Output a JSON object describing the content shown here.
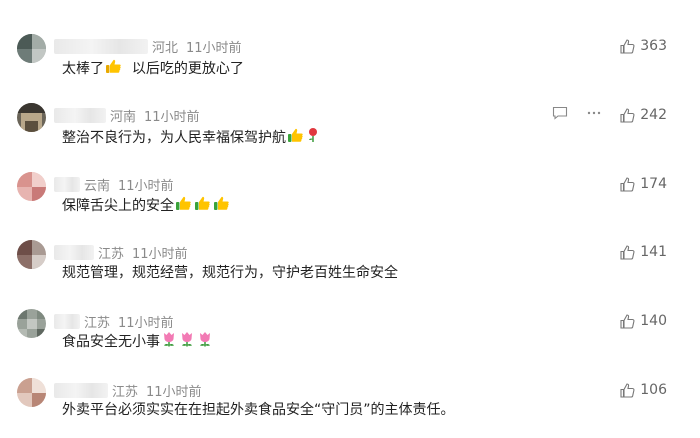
{
  "comments": [
    {
      "location": "河北",
      "time": "11小时前",
      "text_a": "太棒了",
      "text_b": "  以后吃的更放心了",
      "likes": "363"
    },
    {
      "location": "河南",
      "time": "11小时前",
      "text_a": "整治不良行为，为人民幸福保驾护航",
      "text_b": "",
      "likes": "242"
    },
    {
      "location": "云南",
      "time": "11小时前",
      "text_a": "保障舌尖上的安全",
      "text_b": "",
      "likes": "174"
    },
    {
      "location": "江苏",
      "time": "11小时前",
      "text_a": "规范管理，规范经营，规范行为，守护老百姓生命安全",
      "text_b": "",
      "likes": "141"
    },
    {
      "location": "江苏",
      "time": "11小时前",
      "text_a": "食品安全无小事",
      "text_b": "",
      "likes": "140"
    },
    {
      "location": "江苏",
      "time": "11小时前",
      "text_a": "外卖平台必须实实在在担起外卖食品安全“守门员”的主体责任。",
      "text_b": "",
      "likes": "106"
    }
  ],
  "colors": {
    "meta": "#8a8a8a",
    "text": "#222222",
    "like": "#666666"
  }
}
